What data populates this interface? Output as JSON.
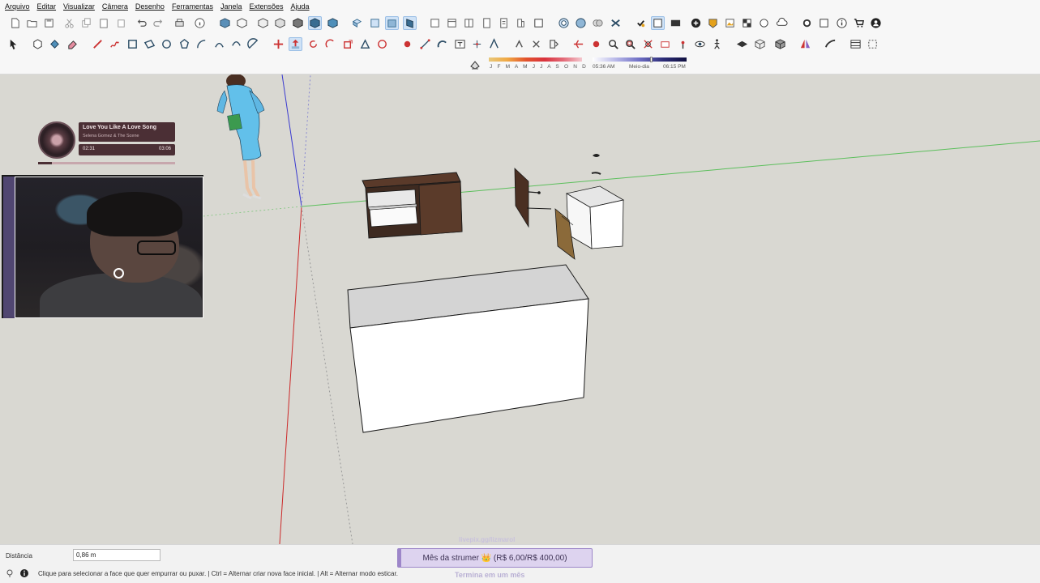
{
  "menu": [
    "Arquivo",
    "Editar",
    "Visualizar",
    "Câmera",
    "Desenho",
    "Ferramentas",
    "Janela",
    "Extensões",
    "Ajuda"
  ],
  "shadow_settings": {
    "months": "J F M A M J J A S O N D",
    "time_start": "05:36 AM",
    "time_mid": "Meio-dia",
    "time_end": "06:15 PM"
  },
  "music": {
    "song_title": "Love You Like A Love Song",
    "artist": "Selena Gomez & The Scene",
    "elapsed": "02:31",
    "duration": "03:06",
    "progress_fraction": 0.1
  },
  "measurements": {
    "label": "Distância",
    "value": "0,86 m"
  },
  "status": {
    "message": "Clique para selecionar a face que quer empurrar ou puxar. | Ctrl = Alternar criar nova face inicial. | Alt = Alternar modo esticar."
  },
  "overlay": {
    "top_text": "livepix.gg/lizmarol",
    "goal_text": "Mês da strumer 👑 (R$ 6,00/R$ 400,00)",
    "bottom_text": "Termina em um mês"
  },
  "colors": {
    "viewport_bg": "#d9d8d2",
    "axis_red": "#cc2a2a",
    "axis_green": "#4caf50",
    "axis_blue": "#3a3ad0",
    "wood_dark": "#4a2f22",
    "accent_active": "#cfe2f6"
  }
}
